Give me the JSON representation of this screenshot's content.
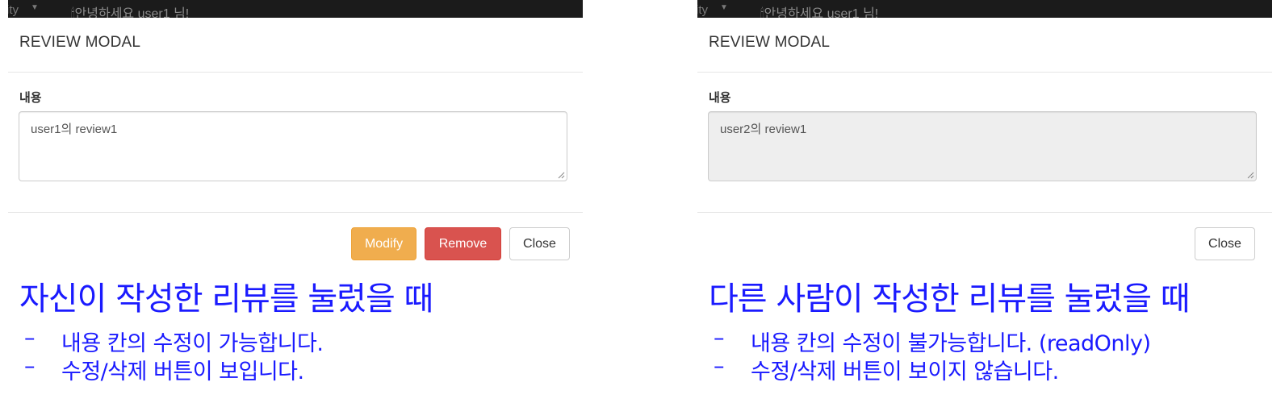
{
  "left": {
    "topbar": {
      "nav_fragment": "ity",
      "greeting_prefix": "🕯안녕하세요 ",
      "greeting_user": "user1",
      "greeting_suffix": " 님!"
    },
    "modal": {
      "title": "REVIEW MODAL",
      "content_label": "내용",
      "content_value": "user1의 review1",
      "read_only": false,
      "buttons": {
        "modify": "Modify",
        "remove": "Remove",
        "close": "Close"
      }
    },
    "caption": "자신이 작성한 리뷰를 눌렀을 때",
    "bullets": [
      "내용 칸의 수정이 가능합니다.",
      "수정/삭제 버튼이 보입니다."
    ]
  },
  "right": {
    "topbar": {
      "nav_fragment": "ity",
      "greeting_prefix": "🕯안녕하세요 ",
      "greeting_user": "user1",
      "greeting_suffix": " 님!"
    },
    "modal": {
      "title": "REVIEW MODAL",
      "content_label": "내용",
      "content_value": "user2의 review1",
      "read_only": true,
      "buttons": {
        "close": "Close"
      }
    },
    "caption": "다른 사람이 작성한 리뷰를 눌렀을 때",
    "bullets": [
      "내용 칸의 수정이 불가능합니다. (readOnly)",
      "수정/삭제 버튼이 보이지 않습니다."
    ]
  },
  "bullet_marker": "–",
  "colors": {
    "navbar_bg": "#1b1b1b",
    "modify_button": "#f0ad4e",
    "remove_button": "#d9534f",
    "annotation_text": "#1a1aff",
    "readonly_bg": "#eeeeee"
  }
}
